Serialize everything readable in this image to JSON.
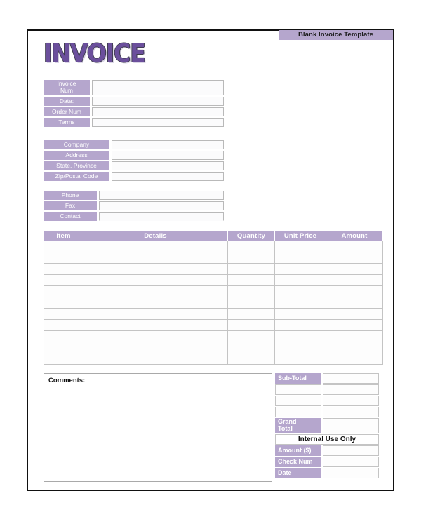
{
  "document": {
    "banner_label": "Blank Invoice Template",
    "title": "INVOICE"
  },
  "colors": {
    "accent_purple": "#b5a6cd",
    "title_purple": "#6b4f9c",
    "field_border": "#b9b9b9",
    "page_border": "#111111"
  },
  "invoice_block": {
    "fields": [
      {
        "label": "Invoice\nNum",
        "value": ""
      },
      {
        "label": "Date:",
        "value": ""
      },
      {
        "label": "Order Num",
        "value": ""
      },
      {
        "label": "Terms",
        "value": ""
      }
    ]
  },
  "company_block": {
    "fields": [
      {
        "label": "Company",
        "value": ""
      },
      {
        "label": "Address",
        "value": ""
      },
      {
        "label": "State, Province",
        "value": ""
      },
      {
        "label": "Zip/Postal Code",
        "value": ""
      }
    ]
  },
  "contact_block": {
    "fields": [
      {
        "label": "Phone",
        "value": ""
      },
      {
        "label": "Fax",
        "value": ""
      },
      {
        "label": "Contact",
        "value": ""
      }
    ]
  },
  "line_items": {
    "columns": [
      "Item",
      "Details",
      "Quantity",
      "Unit Price",
      "Amount"
    ],
    "row_count": 11,
    "rows": [
      [
        "",
        "",
        "",
        "",
        ""
      ],
      [
        "",
        "",
        "",
        "",
        ""
      ],
      [
        "",
        "",
        "",
        "",
        ""
      ],
      [
        "",
        "",
        "",
        "",
        ""
      ],
      [
        "",
        "",
        "",
        "",
        ""
      ],
      [
        "",
        "",
        "",
        "",
        ""
      ],
      [
        "",
        "",
        "",
        "",
        ""
      ],
      [
        "",
        "",
        "",
        "",
        ""
      ],
      [
        "",
        "",
        "",
        "",
        ""
      ],
      [
        "",
        "",
        "",
        "",
        ""
      ],
      [
        "",
        "",
        "",
        "",
        ""
      ]
    ]
  },
  "comments": {
    "label": "Comments:",
    "value": ""
  },
  "totals": {
    "rows": [
      {
        "label": "Sub-Total",
        "value": "",
        "filled": true
      },
      {
        "label": "",
        "value": "",
        "filled": false
      },
      {
        "label": "",
        "value": "",
        "filled": false
      },
      {
        "label": "",
        "value": "",
        "filled": false
      },
      {
        "label": "Grand\nTotal",
        "value": "",
        "filled": true
      }
    ]
  },
  "internal_use": {
    "heading": "Internal Use Only",
    "rows": [
      {
        "label": "Amount ($)",
        "value": ""
      },
      {
        "label": "Check Num",
        "value": ""
      },
      {
        "label": "Date",
        "value": ""
      }
    ]
  }
}
